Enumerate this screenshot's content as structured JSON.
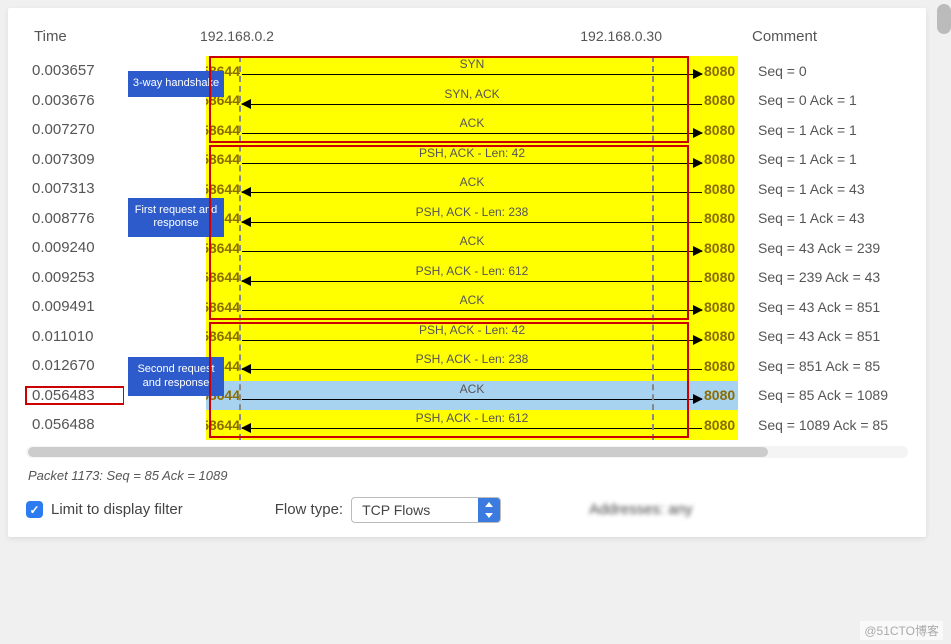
{
  "header": {
    "time_label": "Time",
    "host1": "192.168.0.2",
    "host2": "192.168.0.30",
    "comment_label": "Comment"
  },
  "phases": {
    "p1": "3-way handshake",
    "p2": "First request and response",
    "p3": "Second request and response"
  },
  "rows": [
    {
      "time": "0.003657",
      "src_port": "58644",
      "dst_port": "8080",
      "dir": "right",
      "label": "SYN",
      "comment": "Seq = 0",
      "sel": false
    },
    {
      "time": "0.003676",
      "src_port": "58644",
      "dst_port": "8080",
      "dir": "left",
      "label": "SYN, ACK",
      "comment": "Seq = 0 Ack = 1",
      "sel": false
    },
    {
      "time": "0.007270",
      "src_port": "58644",
      "dst_port": "8080",
      "dir": "right",
      "label": "ACK",
      "comment": "Seq = 1 Ack = 1",
      "sel": false
    },
    {
      "time": "0.007309",
      "src_port": "58644",
      "dst_port": "8080",
      "dir": "right",
      "label": "PSH, ACK - Len: 42",
      "comment": "Seq = 1 Ack = 1",
      "sel": false
    },
    {
      "time": "0.007313",
      "src_port": "58644",
      "dst_port": "8080",
      "dir": "left",
      "label": "ACK",
      "comment": "Seq = 1 Ack = 43",
      "sel": false
    },
    {
      "time": "0.008776",
      "src_port": "58644",
      "dst_port": "8080",
      "dir": "left",
      "label": "PSH, ACK - Len: 238",
      "comment": "Seq = 1 Ack = 43",
      "sel": false
    },
    {
      "time": "0.009240",
      "src_port": "58644",
      "dst_port": "8080",
      "dir": "right",
      "label": "ACK",
      "comment": "Seq = 43 Ack = 239",
      "sel": false
    },
    {
      "time": "0.009253",
      "src_port": "58644",
      "dst_port": "8080",
      "dir": "left",
      "label": "PSH, ACK - Len: 612",
      "comment": "Seq = 239 Ack = 43",
      "sel": false
    },
    {
      "time": "0.009491",
      "src_port": "58644",
      "dst_port": "8080",
      "dir": "right",
      "label": "ACK",
      "comment": "Seq = 43 Ack = 851",
      "sel": false
    },
    {
      "time": "0.011010",
      "src_port": "58644",
      "dst_port": "8080",
      "dir": "right",
      "label": "PSH, ACK - Len: 42",
      "comment": "Seq = 43 Ack = 851",
      "sel": false
    },
    {
      "time": "0.012670",
      "src_port": "58644",
      "dst_port": "8080",
      "dir": "left",
      "label": "PSH, ACK - Len: 238",
      "comment": "Seq = 851 Ack = 85",
      "sel": false
    },
    {
      "time": "0.056483",
      "src_port": "58644",
      "dst_port": "8080",
      "dir": "right",
      "label": "ACK",
      "comment": "Seq = 85 Ack = 1089",
      "sel": true
    },
    {
      "time": "0.056488",
      "src_port": "58644",
      "dst_port": "8080",
      "dir": "left",
      "label": "PSH, ACK - Len: 612",
      "comment": "Seq = 1089 Ack = 85",
      "sel": false
    }
  ],
  "status_line": "Packet 1173: Seq = 85 Ack = 1089",
  "footer": {
    "limit_label": "Limit to display filter",
    "flow_type_label": "Flow type:",
    "flow_type_value": "TCP Flows",
    "addresses_label": "Addresses: any"
  },
  "watermark": "@51CTO博客"
}
